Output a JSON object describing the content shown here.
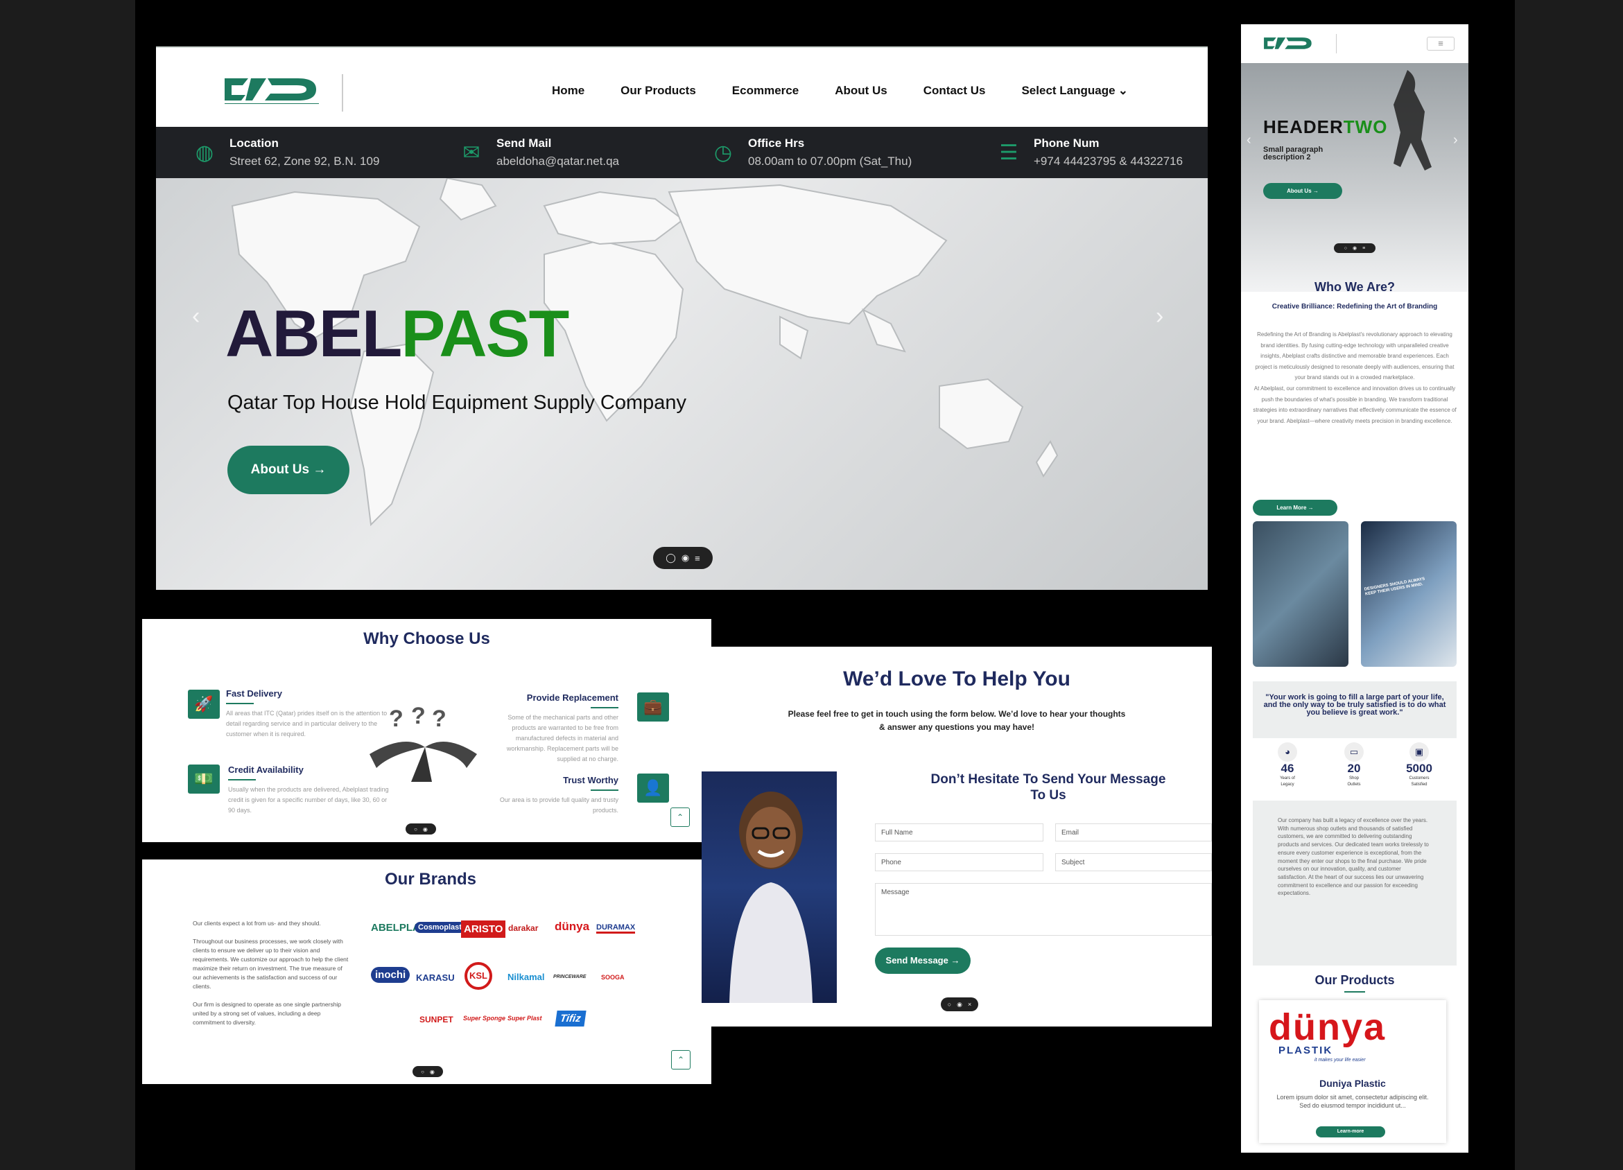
{
  "header": {
    "logo_name": "ABELPLAST",
    "nav": [
      "Home",
      "Our Products",
      "Ecommerce",
      "About Us",
      "Contact Us",
      "Select Language"
    ]
  },
  "info": [
    {
      "title": "Location",
      "value": "Street 62, Zone 92, B.N. 109",
      "icon": "globe-icon"
    },
    {
      "title": "Send Mail",
      "value": "abeldoha@qatar.net.qa",
      "icon": "mail-icon"
    },
    {
      "title": "Office Hrs",
      "value": "08.00am to 07.00pm (Sat_Thu)",
      "icon": "clock-icon"
    },
    {
      "title": "Phone Num",
      "value": "+974 44423795 & 44322716",
      "icon": "user-phone-icon"
    }
  ],
  "hero": {
    "title_a": "ABEL",
    "title_b": "PAST",
    "subtitle": "Qatar Top House Hold Equipment Supply Company",
    "button": "About Us →"
  },
  "why": {
    "title": "Why Choose Us",
    "items": [
      {
        "t": "Fast Delivery",
        "d": "All areas that ITC (Qatar) prides itself on is the attention to detail regarding service and in particular delivery to the customer when it is required."
      },
      {
        "t": "Credit Availability",
        "d": "Usually when the products are delivered, Abelplast trading credit is given for a specific number of days, like 30, 60 or 90 days."
      },
      {
        "t": "Provide Replacement",
        "d": "Some of the mechanical parts and other products are warranted to be free from manufactured defects in material and workmanship. Replacement parts will be supplied at no charge."
      },
      {
        "t": "Trust Worthy",
        "d": "Our area is to provide full quality and trusty products."
      }
    ]
  },
  "brands": {
    "title": "Our Brands",
    "p1": "Our clients expect a lot from us- and they should.",
    "p2": "Throughout our business processes, we work closely with clients to ensure we deliver up to their vision and requirements. We customize our approach to help the client maximize their return on investment. The true measure of our achievements is the satisfaction and success of our clients.",
    "p3": "Our firm is designed to operate as one single partnership united by a strong set of values, including a deep commitment to diversity.",
    "list": [
      "ABELPLAST",
      "Cosmoplast",
      "ARISTO",
      "darakar",
      "dünya",
      "DURAMAX",
      "inochi",
      "KARASU",
      "KSL",
      "Nilkamal",
      "PRINCEWARE",
      "SOOGA",
      "SUNPET",
      "Super Sponge",
      "Super Plast",
      "Tifiz"
    ]
  },
  "contact": {
    "title": "We’d Love To Help You",
    "p1": "Please feel free to get in touch using the form below. We’d love to hear your thoughts",
    "p2": "& answer any questions you may have!",
    "subtitle": "Don’t Hesitate To Send Your Message To Us",
    "fields": [
      "Full Name",
      "Email",
      "Phone",
      "Subject",
      "Message"
    ],
    "button": "Send Message →"
  },
  "mobile": {
    "hero_a": "HEADER",
    "hero_b": "TWO",
    "hero_small": "Small paragraph description 2",
    "hero_btn": "About Us →",
    "who_title": "Who We Are?",
    "who_sub": "Creative Brilliance: Redefining the Art of Branding",
    "who_p1": "Redefining the Art of Branding is Abelplast's revolutionary approach to elevating brand identities. By fusing cutting-edge technology with unparalleled creative insights, Abelplast crafts distinctive and memorable brand experiences. Each project is meticulously designed to resonate deeply with audiences, ensuring that your brand stands out in a crowded marketplace.",
    "who_p2": "At Abelplast, our commitment to excellence and innovation drives us to continually push the boundaries of what's possible in branding. We transform traditional strategies into extraordinary narratives that effectively communicate the essence of your brand. Abelplast—where creativity meets precision in branding excellence.",
    "learn": "Learn More →",
    "img_caption": "DESIGNERS SHOULD ALWAYS KEEP THEIR USERS IN MIND.",
    "quote": "\"Your work is going to fill a large part of your life, and the only way to be truly satisfied is to do what you believe is great work.\"",
    "stats": [
      {
        "n": "46",
        "l1": "Years of",
        "l2": "Legacy"
      },
      {
        "n": "20",
        "l1": "Shop",
        "l2": "Outlets"
      },
      {
        "n": "5000",
        "l1": "Customers",
        "l2": "Satisfied"
      }
    ],
    "quote_p": "Our company has built a legacy of excellence over the years. With numerous shop outlets and thousands of satisfied customers, we are committed to delivering outstanding products and services. Our dedicated team works tirelessly to ensure every customer experience is exceptional, from the moment they enter our shops to the final purchase. We pride ourselves on our innovation, quality, and customer satisfaction. At the heart of our success lies our unwavering commitment to excellence and our passion for exceeding expectations.",
    "products_title": "Our Products",
    "prod_logo": "dünya",
    "prod_logo_sub": "PLASTIK",
    "prod_tag": "it makes your life easier",
    "prod_name": "Duniya Plastic",
    "prod_desc": "Lorem ipsum dolor sit amet, consectetur adipiscing elit. Sed do eiusmod tempor incididunt ut...",
    "prod_btn": "Learn-more"
  }
}
